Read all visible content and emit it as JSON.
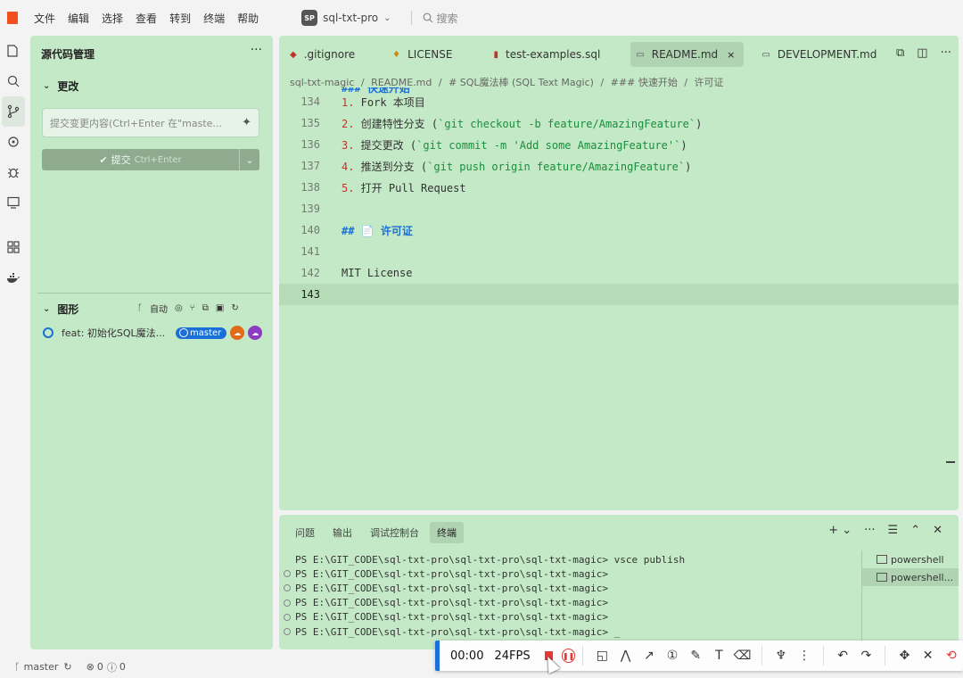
{
  "menu": {
    "items": [
      "文件",
      "编辑",
      "选择",
      "查看",
      "转到",
      "终端",
      "帮助"
    ],
    "project_badge": "SP",
    "project_name": "sql-txt-pro",
    "search_placeholder": "搜索"
  },
  "scm": {
    "title": "源代码管理",
    "more": "···",
    "changes_label": "更改",
    "commit_placeholder": "提交变更内容(Ctrl+Enter 在\"maste...",
    "commit_label": "提交",
    "commit_shortcut": "Ctrl+Enter",
    "graph_label": "图形",
    "graph_tool_auto": "自动",
    "graph_commit": "feat: 初始化SQL魔法...",
    "branch": "master"
  },
  "editor": {
    "tabs": [
      {
        "label": ".gitignore",
        "icon": "git-icon",
        "color": "#c0352b"
      },
      {
        "label": "LICENSE",
        "icon": "license-icon",
        "color": "#c98a1a"
      },
      {
        "label": "test-examples.sql",
        "icon": "database-icon",
        "color": "#c0352b"
      },
      {
        "label": "README.md",
        "icon": "markdown-icon",
        "color": "#555"
      },
      {
        "label": "DEVELOPMENT.md",
        "icon": "markdown-icon",
        "color": "#555"
      }
    ],
    "active_tab_close": "×",
    "breadcrumbs": [
      "sql-txt-magic",
      "/",
      "README.md",
      "/",
      "# SQL魔法棒 (SQL Text Magic)",
      "/",
      "### 快速开始",
      "/",
      "许可证"
    ],
    "partial_line": "### 快速开始",
    "lines": [
      {
        "n": "134",
        "num": "1.",
        "text": " Fork 本项目",
        "code": ""
      },
      {
        "n": "135",
        "num": "2.",
        "text": " 创建特性分支 (",
        "code": "`git checkout -b feature/AmazingFeature`",
        "tail": ")"
      },
      {
        "n": "136",
        "num": "3.",
        "text": " 提交更改 (",
        "code": "`git commit -m 'Add some AmazingFeature'`",
        "tail": ")"
      },
      {
        "n": "137",
        "num": "4.",
        "text": " 推送到分支 (",
        "code": "`git push origin feature/AmazingFeature`",
        "tail": ")"
      },
      {
        "n": "138",
        "num": "5.",
        "text": " 打开 Pull Request",
        "code": ""
      },
      {
        "n": "139",
        "num": "",
        "text": "",
        "code": ""
      },
      {
        "n": "140",
        "h2": "## 📄 许可证"
      },
      {
        "n": "141",
        "num": "",
        "text": "",
        "code": ""
      },
      {
        "n": "142",
        "num": "",
        "text": "MIT License",
        "code": ""
      },
      {
        "n": "143",
        "num": "",
        "text": "",
        "code": "",
        "current": true
      }
    ]
  },
  "panel": {
    "tabs": [
      "问题",
      "输出",
      "调试控制台",
      "终端"
    ],
    "terminal_lines": [
      "PS E:\\GIT_CODE\\sql-txt-pro\\sql-txt-pro\\sql-txt-magic> vsce publish",
      "PS E:\\GIT_CODE\\sql-txt-pro\\sql-txt-pro\\sql-txt-magic>",
      "PS E:\\GIT_CODE\\sql-txt-pro\\sql-txt-pro\\sql-txt-magic>",
      "PS E:\\GIT_CODE\\sql-txt-pro\\sql-txt-pro\\sql-txt-magic>",
      "PS E:\\GIT_CODE\\sql-txt-pro\\sql-txt-pro\\sql-txt-magic>",
      "PS E:\\GIT_CODE\\sql-txt-pro\\sql-txt-pro\\sql-txt-magic> _"
    ],
    "terminals": [
      "powershell",
      "powershell..."
    ]
  },
  "status": {
    "branch": "master",
    "errors": "0",
    "warnings": "0"
  },
  "recorder": {
    "time": "00:00",
    "fps": "24FPS"
  }
}
